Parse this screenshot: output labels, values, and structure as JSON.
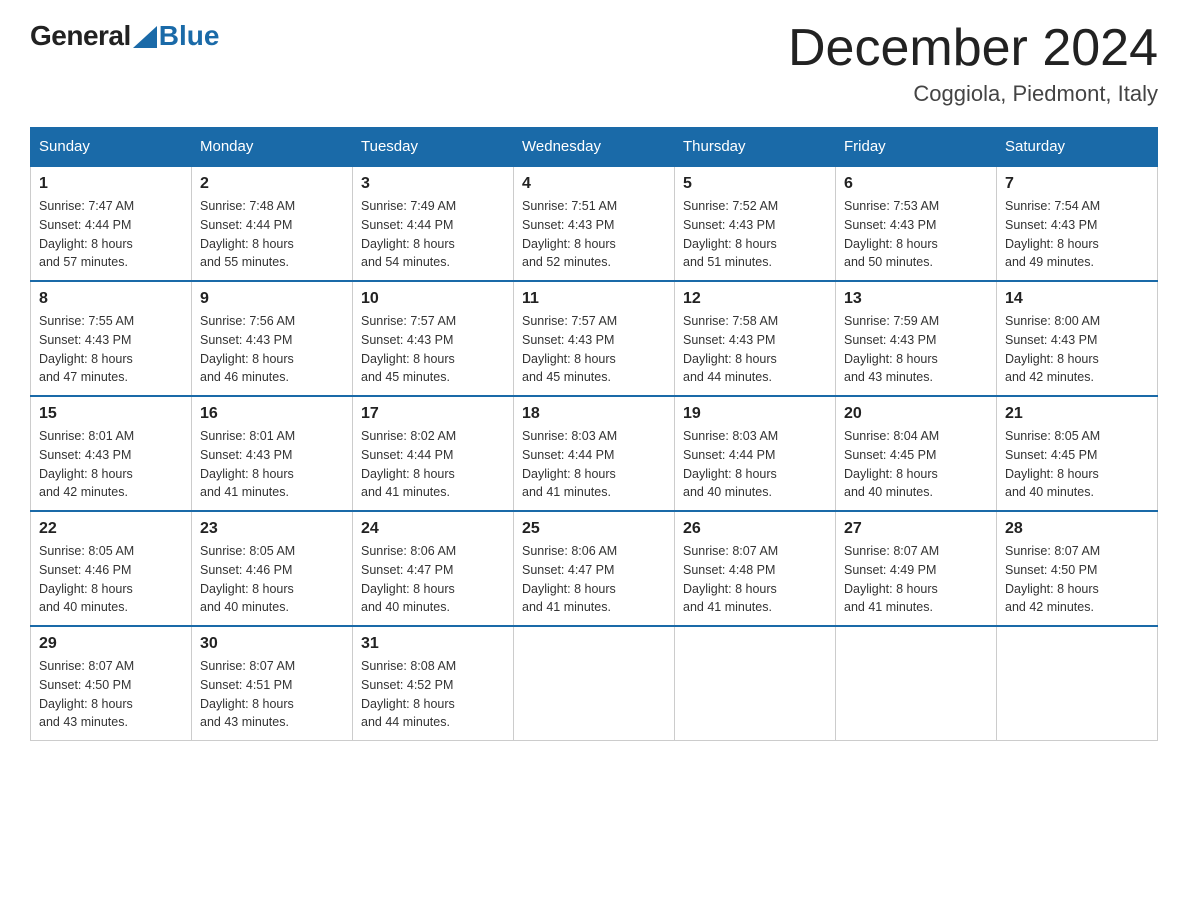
{
  "header": {
    "logo_general": "General",
    "logo_blue": "Blue",
    "month": "December 2024",
    "location": "Coggiola, Piedmont, Italy"
  },
  "days_of_week": [
    "Sunday",
    "Monday",
    "Tuesday",
    "Wednesday",
    "Thursday",
    "Friday",
    "Saturday"
  ],
  "weeks": [
    [
      {
        "day": "1",
        "sunrise": "Sunrise: 7:47 AM",
        "sunset": "Sunset: 4:44 PM",
        "daylight": "Daylight: 8 hours",
        "daylight2": "and 57 minutes."
      },
      {
        "day": "2",
        "sunrise": "Sunrise: 7:48 AM",
        "sunset": "Sunset: 4:44 PM",
        "daylight": "Daylight: 8 hours",
        "daylight2": "and 55 minutes."
      },
      {
        "day": "3",
        "sunrise": "Sunrise: 7:49 AM",
        "sunset": "Sunset: 4:44 PM",
        "daylight": "Daylight: 8 hours",
        "daylight2": "and 54 minutes."
      },
      {
        "day": "4",
        "sunrise": "Sunrise: 7:51 AM",
        "sunset": "Sunset: 4:43 PM",
        "daylight": "Daylight: 8 hours",
        "daylight2": "and 52 minutes."
      },
      {
        "day": "5",
        "sunrise": "Sunrise: 7:52 AM",
        "sunset": "Sunset: 4:43 PM",
        "daylight": "Daylight: 8 hours",
        "daylight2": "and 51 minutes."
      },
      {
        "day": "6",
        "sunrise": "Sunrise: 7:53 AM",
        "sunset": "Sunset: 4:43 PM",
        "daylight": "Daylight: 8 hours",
        "daylight2": "and 50 minutes."
      },
      {
        "day": "7",
        "sunrise": "Sunrise: 7:54 AM",
        "sunset": "Sunset: 4:43 PM",
        "daylight": "Daylight: 8 hours",
        "daylight2": "and 49 minutes."
      }
    ],
    [
      {
        "day": "8",
        "sunrise": "Sunrise: 7:55 AM",
        "sunset": "Sunset: 4:43 PM",
        "daylight": "Daylight: 8 hours",
        "daylight2": "and 47 minutes."
      },
      {
        "day": "9",
        "sunrise": "Sunrise: 7:56 AM",
        "sunset": "Sunset: 4:43 PM",
        "daylight": "Daylight: 8 hours",
        "daylight2": "and 46 minutes."
      },
      {
        "day": "10",
        "sunrise": "Sunrise: 7:57 AM",
        "sunset": "Sunset: 4:43 PM",
        "daylight": "Daylight: 8 hours",
        "daylight2": "and 45 minutes."
      },
      {
        "day": "11",
        "sunrise": "Sunrise: 7:57 AM",
        "sunset": "Sunset: 4:43 PM",
        "daylight": "Daylight: 8 hours",
        "daylight2": "and 45 minutes."
      },
      {
        "day": "12",
        "sunrise": "Sunrise: 7:58 AM",
        "sunset": "Sunset: 4:43 PM",
        "daylight": "Daylight: 8 hours",
        "daylight2": "and 44 minutes."
      },
      {
        "day": "13",
        "sunrise": "Sunrise: 7:59 AM",
        "sunset": "Sunset: 4:43 PM",
        "daylight": "Daylight: 8 hours",
        "daylight2": "and 43 minutes."
      },
      {
        "day": "14",
        "sunrise": "Sunrise: 8:00 AM",
        "sunset": "Sunset: 4:43 PM",
        "daylight": "Daylight: 8 hours",
        "daylight2": "and 42 minutes."
      }
    ],
    [
      {
        "day": "15",
        "sunrise": "Sunrise: 8:01 AM",
        "sunset": "Sunset: 4:43 PM",
        "daylight": "Daylight: 8 hours",
        "daylight2": "and 42 minutes."
      },
      {
        "day": "16",
        "sunrise": "Sunrise: 8:01 AM",
        "sunset": "Sunset: 4:43 PM",
        "daylight": "Daylight: 8 hours",
        "daylight2": "and 41 minutes."
      },
      {
        "day": "17",
        "sunrise": "Sunrise: 8:02 AM",
        "sunset": "Sunset: 4:44 PM",
        "daylight": "Daylight: 8 hours",
        "daylight2": "and 41 minutes."
      },
      {
        "day": "18",
        "sunrise": "Sunrise: 8:03 AM",
        "sunset": "Sunset: 4:44 PM",
        "daylight": "Daylight: 8 hours",
        "daylight2": "and 41 minutes."
      },
      {
        "day": "19",
        "sunrise": "Sunrise: 8:03 AM",
        "sunset": "Sunset: 4:44 PM",
        "daylight": "Daylight: 8 hours",
        "daylight2": "and 40 minutes."
      },
      {
        "day": "20",
        "sunrise": "Sunrise: 8:04 AM",
        "sunset": "Sunset: 4:45 PM",
        "daylight": "Daylight: 8 hours",
        "daylight2": "and 40 minutes."
      },
      {
        "day": "21",
        "sunrise": "Sunrise: 8:05 AM",
        "sunset": "Sunset: 4:45 PM",
        "daylight": "Daylight: 8 hours",
        "daylight2": "and 40 minutes."
      }
    ],
    [
      {
        "day": "22",
        "sunrise": "Sunrise: 8:05 AM",
        "sunset": "Sunset: 4:46 PM",
        "daylight": "Daylight: 8 hours",
        "daylight2": "and 40 minutes."
      },
      {
        "day": "23",
        "sunrise": "Sunrise: 8:05 AM",
        "sunset": "Sunset: 4:46 PM",
        "daylight": "Daylight: 8 hours",
        "daylight2": "and 40 minutes."
      },
      {
        "day": "24",
        "sunrise": "Sunrise: 8:06 AM",
        "sunset": "Sunset: 4:47 PM",
        "daylight": "Daylight: 8 hours",
        "daylight2": "and 40 minutes."
      },
      {
        "day": "25",
        "sunrise": "Sunrise: 8:06 AM",
        "sunset": "Sunset: 4:47 PM",
        "daylight": "Daylight: 8 hours",
        "daylight2": "and 41 minutes."
      },
      {
        "day": "26",
        "sunrise": "Sunrise: 8:07 AM",
        "sunset": "Sunset: 4:48 PM",
        "daylight": "Daylight: 8 hours",
        "daylight2": "and 41 minutes."
      },
      {
        "day": "27",
        "sunrise": "Sunrise: 8:07 AM",
        "sunset": "Sunset: 4:49 PM",
        "daylight": "Daylight: 8 hours",
        "daylight2": "and 41 minutes."
      },
      {
        "day": "28",
        "sunrise": "Sunrise: 8:07 AM",
        "sunset": "Sunset: 4:50 PM",
        "daylight": "Daylight: 8 hours",
        "daylight2": "and 42 minutes."
      }
    ],
    [
      {
        "day": "29",
        "sunrise": "Sunrise: 8:07 AM",
        "sunset": "Sunset: 4:50 PM",
        "daylight": "Daylight: 8 hours",
        "daylight2": "and 43 minutes."
      },
      {
        "day": "30",
        "sunrise": "Sunrise: 8:07 AM",
        "sunset": "Sunset: 4:51 PM",
        "daylight": "Daylight: 8 hours",
        "daylight2": "and 43 minutes."
      },
      {
        "day": "31",
        "sunrise": "Sunrise: 8:08 AM",
        "sunset": "Sunset: 4:52 PM",
        "daylight": "Daylight: 8 hours",
        "daylight2": "and 44 minutes."
      },
      null,
      null,
      null,
      null
    ]
  ]
}
